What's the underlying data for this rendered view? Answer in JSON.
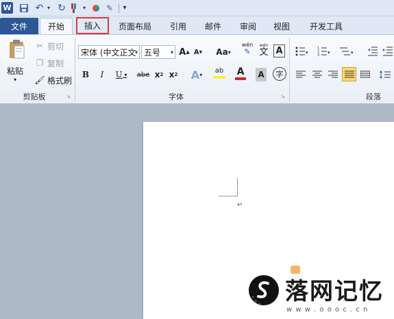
{
  "quick_access": {
    "app_icon_letter": "W",
    "icons": [
      "save-icon",
      "undo-icon",
      "redo-icon",
      "format-painter-icon",
      "color-icon",
      "pen-icon",
      "customize-icon"
    ]
  },
  "tabs": {
    "file": "文件",
    "home": "开始",
    "insert": "插入",
    "layout": "页面布局",
    "references": "引用",
    "mailings": "邮件",
    "review": "审阅",
    "view": "视图",
    "developer": "开发工具",
    "highlighted_tab_color": "#d63a3a",
    "file_tab_color": "#2b5797"
  },
  "clipboard": {
    "paste_label": "粘贴",
    "cut_label": "剪切",
    "copy_label": "复制",
    "format_painter_label": "格式刷",
    "group_label": "剪贴板"
  },
  "font": {
    "font_name": "宋体 (中文正文",
    "font_size": "五号",
    "grow_label": "A",
    "shrink_label": "A",
    "case_label": "Aa",
    "phonetic_label": "wén",
    "phonetic_char": "文",
    "border_label": "A",
    "bold": "B",
    "italic": "I",
    "underline": "U",
    "strike": "abe",
    "subscript": "x",
    "superscript": "x",
    "subscript_sub": "2",
    "superscript_sup": "2",
    "effects": "A",
    "highlight": "ab",
    "color": "A",
    "shading": "A",
    "enclose": "字",
    "group_label": "字体"
  },
  "paragraph": {
    "group_label": "段落"
  },
  "watermark": {
    "text": "落网记忆",
    "url": "w w w . o o o c . c n"
  }
}
